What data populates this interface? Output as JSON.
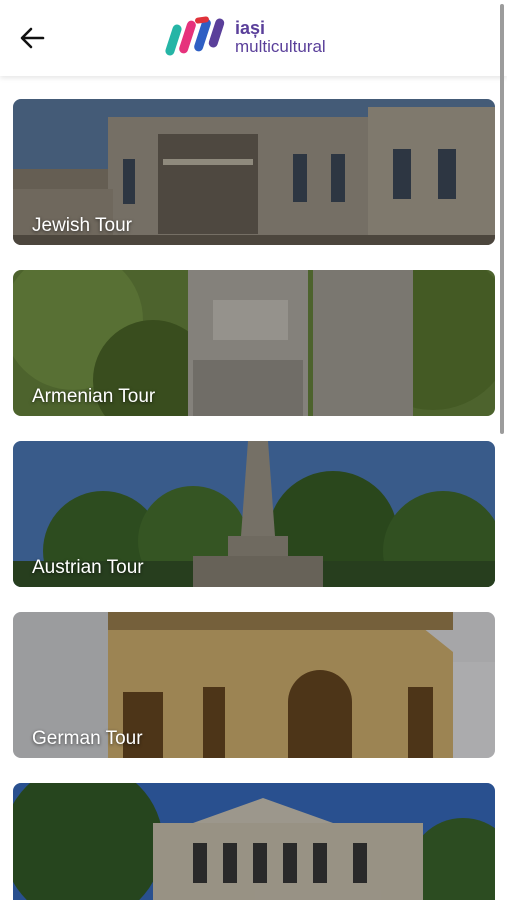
{
  "header": {
    "logo": {
      "line1": "iași",
      "line2": "multicultural"
    }
  },
  "tours": [
    {
      "label": "Jewish Tour"
    },
    {
      "label": "Armenian Tour"
    },
    {
      "label": "Austrian Tour"
    },
    {
      "label": "German Tour"
    },
    {
      "label": ""
    }
  ],
  "colors": {
    "brand_purple": "#5a3f9a",
    "logo_teal": "#25b5a6",
    "logo_pink": "#e6327c",
    "logo_blue": "#2f5fc4",
    "logo_red": "#e0323a"
  }
}
